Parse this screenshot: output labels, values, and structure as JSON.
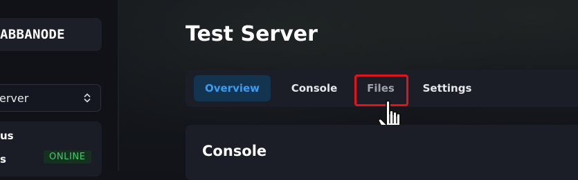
{
  "sidebar": {
    "brand": "ABBANODE",
    "server_select": {
      "value": "erver"
    },
    "status": {
      "row1": "us",
      "row2": "s",
      "badge": "ONLINE"
    },
    "colors": {
      "online": "#3ccf6a"
    }
  },
  "main": {
    "title": "Test Server",
    "tabs": [
      {
        "label": "Overview",
        "active": true
      },
      {
        "label": "Console",
        "active": false
      },
      {
        "label": "Files",
        "active": false
      },
      {
        "label": "Settings",
        "active": false
      }
    ],
    "panel_title": "Console"
  },
  "colors": {
    "accent": "#3b9cf3",
    "highlight": "#e0141b",
    "background": "#111318"
  },
  "icons": [
    "chevron-updown-icon",
    "hand-pointer-icon"
  ]
}
